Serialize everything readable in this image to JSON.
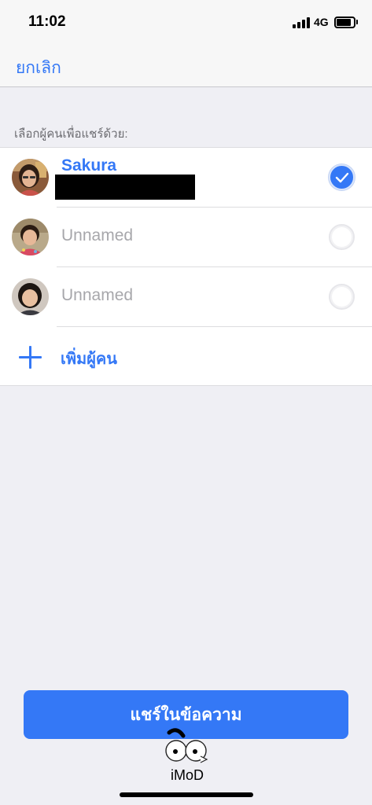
{
  "status_bar": {
    "time": "11:02",
    "network": "4G",
    "icons": [
      "cellular-signal-icon",
      "battery-icon"
    ]
  },
  "nav": {
    "cancel_label": "ยกเลิก"
  },
  "section_header": "เลือกผู้คนเพื่อแชร์ด้วย:",
  "people": [
    {
      "name": "Sakura",
      "selected": true,
      "detail_redacted": true
    },
    {
      "name": "Unnamed",
      "selected": false
    },
    {
      "name": "Unnamed",
      "selected": false
    }
  ],
  "add_people_label": "เพิ่มผู้คน",
  "share_button_label": "แชร์ในข้อความ",
  "watermark_text": "iMoD",
  "colors": {
    "accent": "#3478f6",
    "background": "#efeff4",
    "unselected_text": "#a7a7ab"
  }
}
